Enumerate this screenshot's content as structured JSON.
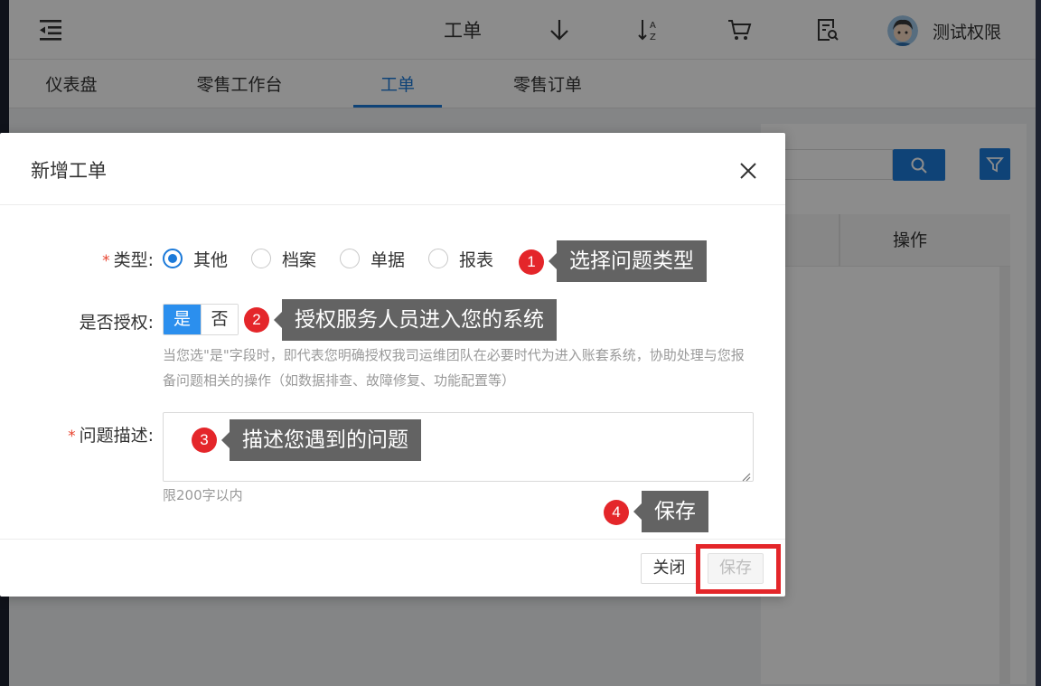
{
  "topbar": {
    "menu_icon": "indent-menu-icon",
    "workorder_label": "工单",
    "icons": [
      "download-arrow-icon",
      "sort-az-icon",
      "cart-icon",
      "document-search-icon"
    ],
    "user_name": "测试权限"
  },
  "tabs": [
    {
      "label": "仪表盘",
      "active": false
    },
    {
      "label": "零售工作台",
      "active": false
    },
    {
      "label": "工单",
      "active": true
    },
    {
      "label": "零售订单",
      "active": false
    }
  ],
  "background_table": {
    "operation_header": "操作"
  },
  "dialog": {
    "title": "新增工单",
    "type_field": {
      "label": "类型:",
      "options": [
        "其他",
        "档案",
        "单据",
        "报表"
      ],
      "selected": "其他"
    },
    "authorize_field": {
      "label": "是否授权:",
      "yes": "是",
      "no": "否",
      "selected": "是",
      "hint": "当您选\"是\"字段时，即代表您明确授权我司运维团队在必要时代为进入账套系统，协助处理与您报备问题相关的操作（如数据排查、故障修复、功能配置等）"
    },
    "description_field": {
      "label": "问题描述:",
      "value": "",
      "limit_text": "限200字以内"
    },
    "buttons": {
      "close": "关闭",
      "save": "保存"
    }
  },
  "annotations": [
    {
      "number": "1",
      "text": "选择问题类型"
    },
    {
      "number": "2",
      "text": "授权服务人员进入您的系统"
    },
    {
      "number": "3",
      "text": "描述您遇到的问题"
    },
    {
      "number": "4",
      "text": "保存"
    }
  ],
  "colors": {
    "primary": "#1c7ad9",
    "highlight_red": "#e4262a",
    "callout_bg": "#636363"
  }
}
